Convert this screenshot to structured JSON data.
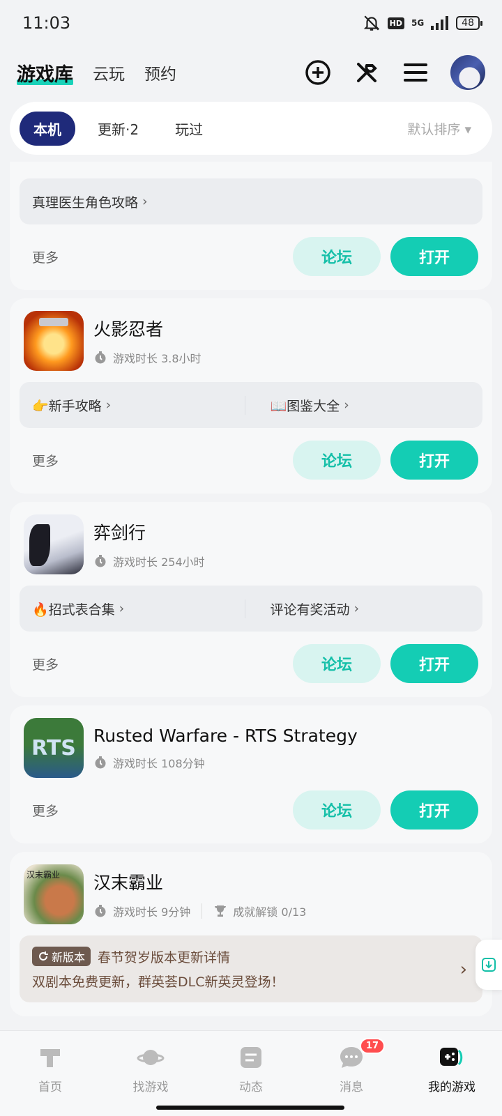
{
  "status": {
    "time": "11:03",
    "network": "5G",
    "hd": "HD",
    "battery": "48"
  },
  "top_nav": {
    "tabs": [
      {
        "label": "游戏库"
      },
      {
        "label": "云玩"
      },
      {
        "label": "预约"
      }
    ]
  },
  "filter": {
    "chips": [
      {
        "label": "本机"
      },
      {
        "label": "更新·2"
      },
      {
        "label": "玩过"
      }
    ],
    "sort_label": "默认排序 ▾"
  },
  "partial_card": {
    "link": "真理医生角色攻略",
    "more": "更多",
    "forum": "论坛",
    "open": "打开"
  },
  "games": [
    {
      "title": "火影忍者",
      "playtime": "游戏时长 3.8小时",
      "links": [
        "👉新手攻略",
        "📖图鉴大全"
      ],
      "more": "更多",
      "forum": "论坛",
      "open": "打开"
    },
    {
      "title": "弈剑行",
      "playtime": "游戏时长 254小时",
      "links": [
        "🔥招式表合集",
        "评论有奖活动"
      ],
      "more": "更多",
      "forum": "论坛",
      "open": "打开"
    },
    {
      "title": "Rusted Warfare - RTS Strategy",
      "playtime": "游戏时长 108分钟",
      "icon_text": "RTS",
      "more": "更多",
      "forum": "论坛",
      "open": "打开"
    },
    {
      "title": "汉末霸业",
      "playtime": "游戏时长 9分钟",
      "achievement": "成就解锁 0/13",
      "icon_text": "汉末霸业",
      "update_badge": "新版本",
      "update_title": "春节贺岁版本更新详情",
      "update_desc": "双剧本免费更新，群英荟DLC新英灵登场！"
    }
  ],
  "bottom_nav": {
    "items": [
      {
        "label": "首页"
      },
      {
        "label": "找游戏"
      },
      {
        "label": "动态"
      },
      {
        "label": "消息"
      },
      {
        "label": "我的游戏"
      }
    ],
    "message_badge": "17"
  },
  "colors": {
    "accent": "#14cdb4",
    "chip_active": "#1f2a7a",
    "badge": "#ff4d4f"
  }
}
